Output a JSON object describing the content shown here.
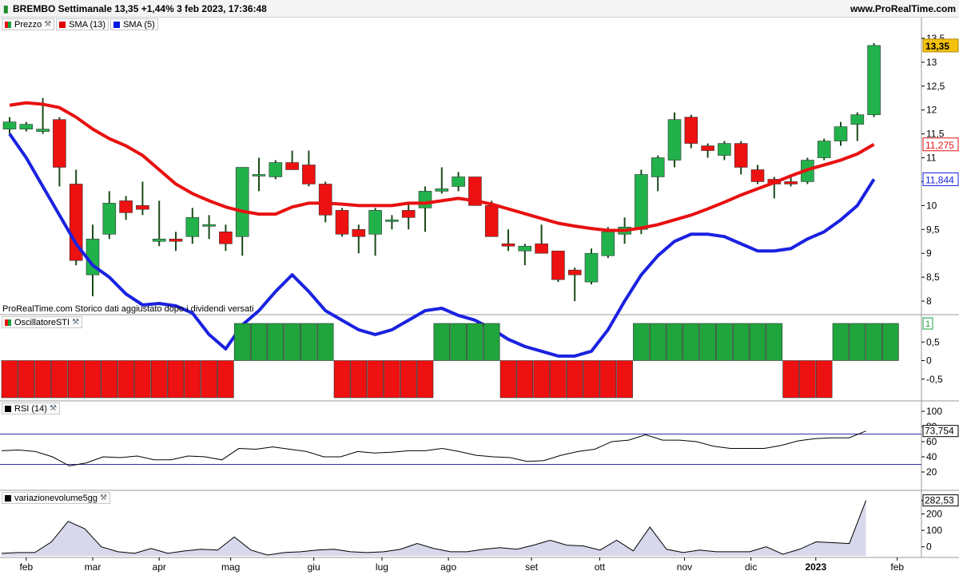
{
  "header": {
    "title": "BREMBO Settimanale 13,35 +1,44% 3 feb 2023, 17:36:48",
    "site": "www.ProRealTime.com"
  },
  "legend_price": {
    "items": [
      {
        "label": "Prezzo",
        "color": "#1aa23a"
      },
      {
        "label": "SMA (13)",
        "color": "#e00000"
      },
      {
        "label": "SMA (5)",
        "color": "#0018e0"
      }
    ]
  },
  "note": "ProRealTime.com Storico dati aggiustato dopo i dividendi versati",
  "legend_sti": {
    "label": "OscillatoreSTI",
    "color": "#1aa23a"
  },
  "legend_rsi": {
    "label": "RSI (14)",
    "color": "#000000"
  },
  "legend_vol": {
    "label": "variazionevolume5gg",
    "color": "#000000"
  },
  "colors": {
    "up": "#22b24c",
    "down": "#ee1111",
    "sma13": "#e81010",
    "sma5": "#1a22e0",
    "rsi_line": "#000000",
    "rsi_levels": "#3030a0",
    "vol_fill": "#d8d8ec",
    "vol_line": "#000000"
  },
  "chart_data": [
    {
      "type": "candlestick",
      "name": "Prezzo",
      "ylim": [
        7.8,
        13.7
      ],
      "yticks": [
        "13,5",
        "13",
        "12,5",
        "12",
        "11,5",
        "11",
        "10,5",
        "10",
        "9,5",
        "9",
        "8,5",
        "8"
      ],
      "ytick_values": [
        13.5,
        13,
        12.5,
        12,
        11.5,
        11,
        10.5,
        10,
        9.5,
        9,
        8.5,
        8
      ],
      "xticks": [
        "feb",
        "mar",
        "apr",
        "mag",
        "giu",
        "lug",
        "ago",
        "set",
        "ott",
        "nov",
        "dic",
        "2023",
        "feb"
      ],
      "xtick_week_index": [
        1.0,
        5.0,
        9.0,
        13.3,
        18.3,
        22.4,
        26.4,
        31.4,
        35.5,
        40.6,
        44.6,
        48.5,
        53.4
      ],
      "candles": [
        {
          "o": 11.6,
          "h": 11.85,
          "l": 11.5,
          "c": 11.75
        },
        {
          "o": 11.6,
          "h": 11.75,
          "l": 11.55,
          "c": 11.7
        },
        {
          "o": 11.55,
          "h": 12.25,
          "l": 11.5,
          "c": 11.6
        },
        {
          "o": 11.8,
          "h": 11.85,
          "l": 10.4,
          "c": 10.8
        },
        {
          "o": 10.45,
          "h": 10.75,
          "l": 8.75,
          "c": 8.85
        },
        {
          "o": 8.55,
          "h": 9.6,
          "l": 8.1,
          "c": 9.3
        },
        {
          "o": 9.4,
          "h": 10.3,
          "l": 9.3,
          "c": 10.05
        },
        {
          "o": 10.1,
          "h": 10.2,
          "l": 9.7,
          "c": 9.85
        },
        {
          "o": 10.0,
          "h": 10.5,
          "l": 9.8,
          "c": 9.92
        },
        {
          "o": 9.25,
          "h": 10.1,
          "l": 9.15,
          "c": 9.3
        },
        {
          "o": 9.3,
          "h": 9.45,
          "l": 9.05,
          "c": 9.25
        },
        {
          "o": 9.35,
          "h": 9.95,
          "l": 9.2,
          "c": 9.75
        },
        {
          "o": 9.6,
          "h": 9.8,
          "l": 9.3,
          "c": 9.6
        },
        {
          "o": 9.45,
          "h": 9.6,
          "l": 9.05,
          "c": 9.2
        },
        {
          "o": 9.35,
          "h": 10.8,
          "l": 8.95,
          "c": 10.8
        },
        {
          "o": 10.65,
          "h": 11.0,
          "l": 10.3,
          "c": 10.65
        },
        {
          "o": 10.6,
          "h": 10.95,
          "l": 10.55,
          "c": 10.9
        },
        {
          "o": 10.9,
          "h": 11.15,
          "l": 10.75,
          "c": 10.75
        },
        {
          "o": 10.85,
          "h": 11.15,
          "l": 10.4,
          "c": 10.45
        },
        {
          "o": 10.45,
          "h": 10.5,
          "l": 9.65,
          "c": 9.8
        },
        {
          "o": 9.9,
          "h": 9.95,
          "l": 9.35,
          "c": 9.4
        },
        {
          "o": 9.5,
          "h": 9.6,
          "l": 9.0,
          "c": 9.35
        },
        {
          "o": 9.4,
          "h": 9.95,
          "l": 8.95,
          "c": 9.9
        },
        {
          "o": 9.7,
          "h": 9.8,
          "l": 9.5,
          "c": 9.7
        },
        {
          "o": 9.9,
          "h": 10.05,
          "l": 9.5,
          "c": 9.75
        },
        {
          "o": 9.95,
          "h": 10.4,
          "l": 9.45,
          "c": 10.3
        },
        {
          "o": 10.3,
          "h": 10.8,
          "l": 10.25,
          "c": 10.35
        },
        {
          "o": 10.4,
          "h": 10.7,
          "l": 10.3,
          "c": 10.6
        },
        {
          "o": 10.6,
          "h": 10.6,
          "l": 10.0,
          "c": 10.0
        },
        {
          "o": 10.0,
          "h": 10.1,
          "l": 9.35,
          "c": 9.35
        },
        {
          "o": 9.2,
          "h": 9.5,
          "l": 9.05,
          "c": 9.15
        },
        {
          "o": 9.05,
          "h": 9.2,
          "l": 8.75,
          "c": 9.15
        },
        {
          "o": 9.2,
          "h": 9.6,
          "l": 9.0,
          "c": 9.0
        },
        {
          "o": 9.05,
          "h": 9.05,
          "l": 8.4,
          "c": 8.45
        },
        {
          "o": 8.65,
          "h": 8.7,
          "l": 8.0,
          "c": 8.55
        },
        {
          "o": 8.4,
          "h": 9.1,
          "l": 8.35,
          "c": 9.0
        },
        {
          "o": 8.95,
          "h": 9.55,
          "l": 8.9,
          "c": 9.45
        },
        {
          "o": 9.4,
          "h": 9.75,
          "l": 9.2,
          "c": 9.55
        },
        {
          "o": 9.5,
          "h": 10.75,
          "l": 9.4,
          "c": 10.65
        },
        {
          "o": 10.6,
          "h": 11.05,
          "l": 10.3,
          "c": 11.0
        },
        {
          "o": 10.95,
          "h": 11.95,
          "l": 10.8,
          "c": 11.8
        },
        {
          "o": 11.85,
          "h": 11.9,
          "l": 11.2,
          "c": 11.3
        },
        {
          "o": 11.25,
          "h": 11.3,
          "l": 11.0,
          "c": 11.15
        },
        {
          "o": 11.05,
          "h": 11.35,
          "l": 10.95,
          "c": 11.3
        },
        {
          "o": 11.3,
          "h": 11.35,
          "l": 10.65,
          "c": 10.8
        },
        {
          "o": 10.75,
          "h": 10.85,
          "l": 10.45,
          "c": 10.5
        },
        {
          "o": 10.55,
          "h": 10.6,
          "l": 10.15,
          "c": 10.45
        },
        {
          "o": 10.5,
          "h": 10.6,
          "l": 10.4,
          "c": 10.45
        },
        {
          "o": 10.5,
          "h": 11.0,
          "l": 10.45,
          "c": 10.95
        },
        {
          "o": 11.0,
          "h": 11.4,
          "l": 10.95,
          "c": 11.35
        },
        {
          "o": 11.35,
          "h": 11.75,
          "l": 11.25,
          "c": 11.65
        },
        {
          "o": 11.7,
          "h": 11.95,
          "l": 11.35,
          "c": 11.9
        },
        {
          "o": 11.9,
          "h": 13.4,
          "l": 11.85,
          "c": 13.35
        }
      ],
      "sma13": [
        12.1,
        12.15,
        12.12,
        12.05,
        11.85,
        11.6,
        11.4,
        11.25,
        11.05,
        10.75,
        10.45,
        10.25,
        10.1,
        9.97,
        9.88,
        9.82,
        9.82,
        9.97,
        10.05,
        10.05,
        10.03,
        10.0,
        10.0,
        10.0,
        10.05,
        10.05,
        10.1,
        10.15,
        10.1,
        10.03,
        9.93,
        9.83,
        9.73,
        9.63,
        9.57,
        9.52,
        9.48,
        9.48,
        9.53,
        9.6,
        9.7,
        9.8,
        9.93,
        10.07,
        10.22,
        10.35,
        10.48,
        10.62,
        10.75,
        10.85,
        10.95,
        11.08,
        11.28
      ],
      "sma5": [
        11.5,
        11.0,
        10.4,
        9.8,
        9.2,
        8.75,
        8.5,
        8.15,
        7.92,
        7.95,
        7.9,
        7.75,
        7.3,
        7.0,
        7.5,
        7.8,
        8.2,
        8.55,
        8.2,
        7.8,
        7.6,
        7.4,
        7.3,
        7.4,
        7.6,
        7.8,
        7.85,
        7.7,
        7.6,
        7.42,
        7.2,
        7.05,
        6.95,
        6.85,
        6.85,
        6.95,
        7.4,
        8.0,
        8.55,
        8.95,
        9.25,
        9.4,
        9.4,
        9.35,
        9.2,
        9.05,
        9.05,
        9.1,
        9.3,
        9.45,
        9.7,
        10.0,
        10.55
      ],
      "last_labels": {
        "price": "13,35",
        "sma5": "11,844",
        "sma13": "11,275"
      }
    },
    {
      "type": "bar",
      "name": "OscillatoreSTI",
      "ylim": [
        -1,
        1
      ],
      "yticks": [
        "0,5",
        "0",
        "-0,5"
      ],
      "ytick_values": [
        0.5,
        0,
        -0.5
      ],
      "values": [
        -1,
        -1,
        -1,
        -1,
        -1,
        -1,
        -1,
        -1,
        -1,
        -1,
        -1,
        -1,
        -1,
        -1,
        1,
        1,
        1,
        1,
        1,
        1,
        -1,
        -1,
        -1,
        -1,
        -1,
        -1,
        1,
        1,
        1,
        1,
        -1,
        -1,
        -1,
        -1,
        -1,
        -1,
        -1,
        -1,
        1,
        1,
        1,
        1,
        1,
        1,
        1,
        1,
        1,
        -1,
        -1,
        -1,
        1,
        1,
        1,
        1
      ],
      "last_label": "1"
    },
    {
      "type": "line",
      "name": "RSI (14)",
      "ylim": [
        0,
        100
      ],
      "yticks": [
        "100",
        "80",
        "60",
        "40",
        "20"
      ],
      "ytick_values": [
        100,
        80,
        60,
        40,
        20
      ],
      "levels": [
        70,
        30
      ],
      "values": [
        48,
        49,
        47,
        40,
        28,
        32,
        40,
        39,
        41,
        36,
        36,
        41,
        40,
        36,
        51,
        50,
        53,
        50,
        47,
        40,
        40,
        47,
        45,
        46,
        48,
        48,
        51,
        47,
        42,
        40,
        39,
        34,
        35,
        42,
        47,
        50,
        60,
        62,
        69,
        62,
        62,
        60,
        54,
        51,
        51,
        51,
        55,
        61,
        64,
        65,
        65,
        74
      ],
      "last_label": "73,754"
    },
    {
      "type": "area",
      "name": "variazionevolume5gg",
      "ylim": [
        -55,
        300
      ],
      "yticks": [
        "282,53",
        "200",
        "100",
        "0"
      ],
      "ytick_values": [
        282.53,
        200,
        100,
        0
      ],
      "values": [
        -40,
        -35,
        -35,
        30,
        155,
        110,
        0,
        -30,
        -40,
        -10,
        -40,
        -25,
        -15,
        -20,
        60,
        -20,
        -50,
        -35,
        -30,
        -20,
        -15,
        -30,
        -35,
        -30,
        -15,
        20,
        -10,
        -30,
        -30,
        -15,
        -5,
        -15,
        10,
        40,
        10,
        5,
        -20,
        40,
        -25,
        120,
        -15,
        -35,
        -20,
        -30,
        -30,
        -30,
        0,
        -45,
        -15,
        30,
        25,
        20,
        282.53
      ],
      "last_label": "282,53"
    }
  ]
}
